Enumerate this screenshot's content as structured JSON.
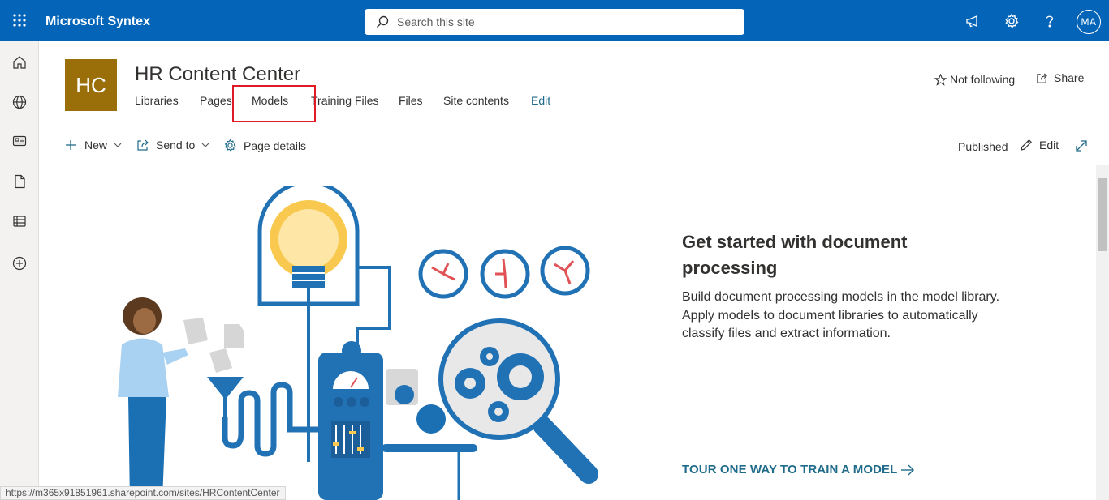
{
  "topbar": {
    "app_name": "Microsoft Syntex",
    "search_placeholder": "Search this site",
    "user_initials": "MA",
    "icons": [
      "waffle-icon",
      "megaphone-icon",
      "gear-icon",
      "help-icon"
    ]
  },
  "leftnav": {
    "items": [
      "home-icon",
      "globe-icon",
      "news-icon",
      "document-icon",
      "lists-icon",
      "add-icon"
    ]
  },
  "site": {
    "logo_initials": "HC",
    "logo_color": "#9a6e09",
    "title": "HR Content Center",
    "nav": [
      {
        "label": "Libraries"
      },
      {
        "label": "Pages"
      },
      {
        "label": "Models"
      },
      {
        "label": "Training Files"
      },
      {
        "label": "Files"
      },
      {
        "label": "Site contents"
      },
      {
        "label": "Edit"
      }
    ],
    "follow_label": "Not following",
    "share_label": "Share"
  },
  "commandbar": {
    "new_label": "New",
    "send_label": "Send to",
    "details_label": "Page details",
    "status_label": "Published",
    "edit_label": "Edit"
  },
  "hero": {
    "heading": "Get started with document processing",
    "description": "Build document processing models in the model library. Apply models to document libraries to automatically classify files and extract information.",
    "link_label": "TOUR ONE WAY TO TRAIN A MODEL",
    "accent_color": "#1f6b8a"
  },
  "statusbar": {
    "url": "https://m365x91851961.sharepoint.com/sites/HRContentCenter"
  }
}
